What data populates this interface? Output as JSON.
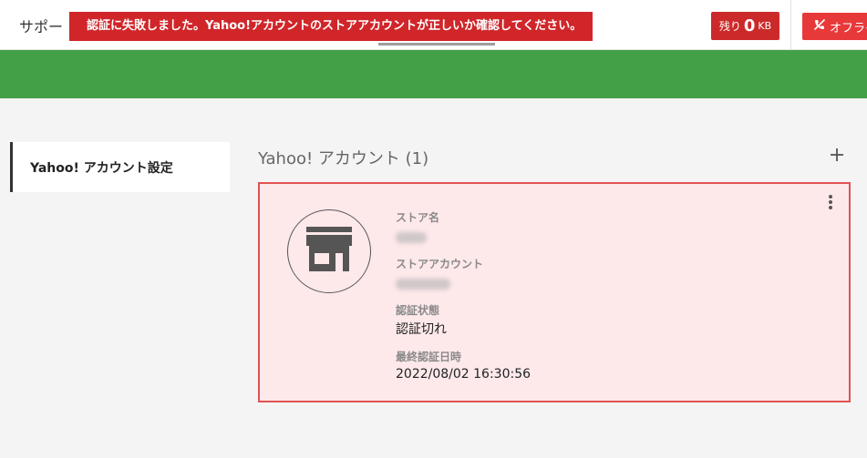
{
  "header": {
    "support_label": "サポー",
    "error_message": "認証に失敗しました。Yahoo!アカウントのストアアカウントが正しいか確認してください。",
    "remaining": {
      "prefix": "残り",
      "value": "0",
      "unit": "KB"
    },
    "offline_label": "オフライ"
  },
  "sidebar": {
    "items": [
      {
        "label": "Yahoo! アカウント設定"
      }
    ]
  },
  "main": {
    "section_title": "Yahoo! アカウント (1)",
    "card": {
      "store_name_label": "ストア名",
      "store_account_label": "ストアアカウント",
      "auth_status_label": "認証状態",
      "auth_status_value": "認証切れ",
      "last_auth_label": "最終認証日時",
      "last_auth_value": "2022/08/02 16:30:56"
    }
  },
  "icons": {
    "add": "plus-icon",
    "more": "more-vertical-icon",
    "store": "store-icon",
    "offline": "phone-off-icon"
  },
  "colors": {
    "error_red": "#d0262a",
    "green_band": "#43a047",
    "card_background": "#fde8ea",
    "card_border": "#e05252"
  }
}
